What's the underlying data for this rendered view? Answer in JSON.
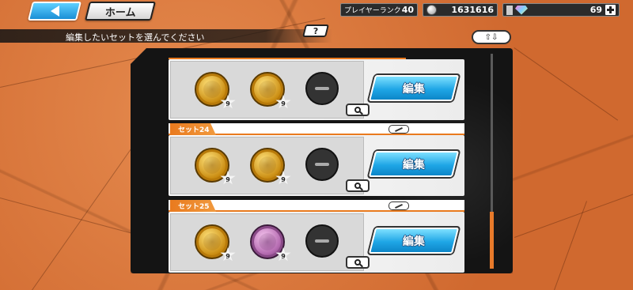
{
  "header": {
    "home_label": "ホーム",
    "rank_label": "プレイヤーランク",
    "rank_value": "40",
    "coins": "1631616",
    "gems": "69"
  },
  "instruction": "編集したいセットを選んでください",
  "help_label": "?",
  "sort_label": "⇧⇩",
  "icons": {
    "back": "back-arrow-icon",
    "coin": "coin-icon",
    "gem": "gem-icon",
    "plus": "plus-icon",
    "sort": "sort-arrows-icon",
    "zoom": "magnifier-icon",
    "rename": "pen-icon"
  },
  "colors": {
    "accent_orange": "#e97a1e",
    "button_blue": "#1fa6e6",
    "medal_gold": "#c98b10",
    "medal_pink": "#b46ab0"
  },
  "sets": [
    {
      "label": "",
      "edit_label": "編集",
      "medals": [
        {
          "type": "gold",
          "stars": "9"
        },
        {
          "type": "gold",
          "stars": "9"
        }
      ]
    },
    {
      "label": "セット24",
      "edit_label": "編集",
      "medals": [
        {
          "type": "gold",
          "stars": "9"
        },
        {
          "type": "gold",
          "stars": "9"
        }
      ]
    },
    {
      "label": "セット25",
      "edit_label": "編集",
      "medals": [
        {
          "type": "gold",
          "stars": "9"
        },
        {
          "type": "pink",
          "stars": "9"
        }
      ]
    }
  ]
}
